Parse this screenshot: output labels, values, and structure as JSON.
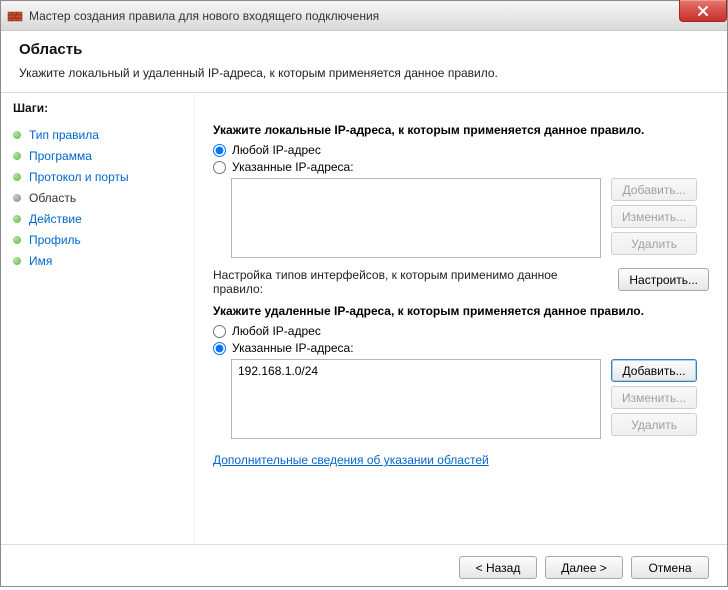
{
  "window": {
    "title": "Мастер создания правила для нового входящего подключения"
  },
  "header": {
    "title": "Область",
    "subtitle": "Укажите локальный и удаленный IP-адреса, к которым применяется данное правило."
  },
  "sidebar": {
    "steps_label": "Шаги:",
    "items": [
      {
        "label": "Тип правила",
        "current": false
      },
      {
        "label": "Программа",
        "current": false
      },
      {
        "label": "Протокол и порты",
        "current": false
      },
      {
        "label": "Область",
        "current": true
      },
      {
        "label": "Действие",
        "current": false
      },
      {
        "label": "Профиль",
        "current": false
      },
      {
        "label": "Имя",
        "current": false
      }
    ]
  },
  "local": {
    "heading": "Укажите локальные IP-адреса, к которым применяется данное правило.",
    "radio_any": "Любой IP-адрес",
    "radio_specified": "Указанные IP-адреса:",
    "selected": "any",
    "list": [],
    "btn_add": "Добавить...",
    "btn_edit": "Изменить...",
    "btn_delete": "Удалить"
  },
  "iface": {
    "text": "Настройка типов интерфейсов, к которым применимо данное правило:",
    "btn": "Настроить..."
  },
  "remote": {
    "heading": "Укажите удаленные IP-адреса, к которым применяется данное правило.",
    "radio_any": "Любой IP-адрес",
    "radio_specified": "Указанные IP-адреса:",
    "selected": "specified",
    "list": [
      "192.168.1.0/24"
    ],
    "btn_add": "Добавить...",
    "btn_edit": "Изменить...",
    "btn_delete": "Удалить"
  },
  "link_more": "Дополнительные сведения об указании областей",
  "footer": {
    "back": "< Назад",
    "next": "Далее >",
    "cancel": "Отмена"
  }
}
